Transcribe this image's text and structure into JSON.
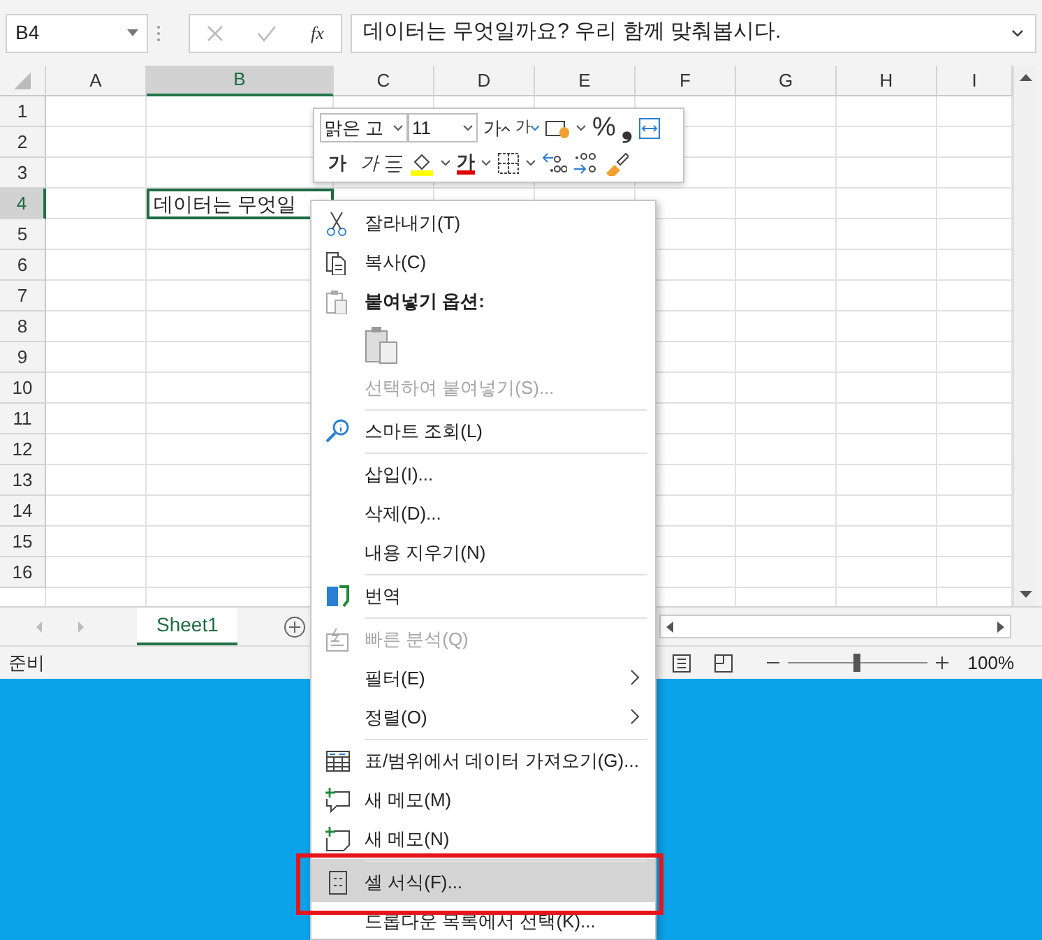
{
  "name_box": {
    "value": "B4"
  },
  "formula_bar": {
    "function_label": "fx",
    "value": "데이터는 무엇일까요? 우리 함께 맞춰봅시다."
  },
  "columns": [
    {
      "label": "A",
      "selected": false
    },
    {
      "label": "B",
      "selected": true
    },
    {
      "label": "C",
      "selected": false
    },
    {
      "label": "D",
      "selected": false
    },
    {
      "label": "E",
      "selected": false
    },
    {
      "label": "F",
      "selected": false
    },
    {
      "label": "G",
      "selected": false
    },
    {
      "label": "H",
      "selected": false
    },
    {
      "label": "I",
      "selected": false
    }
  ],
  "rows": [
    {
      "label": "1",
      "selected": false
    },
    {
      "label": "2",
      "selected": false
    },
    {
      "label": "3",
      "selected": false
    },
    {
      "label": "4",
      "selected": true
    },
    {
      "label": "5",
      "selected": false
    },
    {
      "label": "6",
      "selected": false
    },
    {
      "label": "7",
      "selected": false
    },
    {
      "label": "8",
      "selected": false
    },
    {
      "label": "9",
      "selected": false
    },
    {
      "label": "10",
      "selected": false
    },
    {
      "label": "11",
      "selected": false
    },
    {
      "label": "12",
      "selected": false
    },
    {
      "label": "13",
      "selected": false
    },
    {
      "label": "14",
      "selected": false
    },
    {
      "label": "15",
      "selected": false
    },
    {
      "label": "16",
      "selected": false
    }
  ],
  "active_cell": {
    "text": "데이터는 무엇일"
  },
  "sheet_tabs": [
    {
      "label": "Sheet1",
      "selected": true
    }
  ],
  "status_bar": {
    "status": "준비",
    "zoom_slider": {
      "level": 0.5
    },
    "zoom": "100%"
  },
  "mini_toolbar": {
    "font": "맑은 고",
    "size": "11",
    "grow": "가",
    "shrink": "가",
    "percent": "%",
    "comma": "❟",
    "bold": "가",
    "italic": "가",
    "font_color_label": "가"
  },
  "context_menu": [
    {
      "kind": "item",
      "label": "잘라내기(T)",
      "disabled": false,
      "submenu": false,
      "selected": false,
      "divider_before": false
    },
    {
      "kind": "item",
      "label": "복사(C)",
      "disabled": false,
      "submenu": false,
      "selected": false,
      "divider_before": false
    },
    {
      "kind": "header",
      "label": "붙여넣기 옵션:",
      "disabled": false,
      "submenu": false,
      "selected": false,
      "divider_before": false
    },
    {
      "kind": "paste-options"
    },
    {
      "kind": "item",
      "label": "선택하여 붙여넣기(S)...",
      "disabled": true,
      "submenu": false,
      "selected": false,
      "divider_before": false
    },
    {
      "kind": "item",
      "label": "스마트 조회(L)",
      "disabled": false,
      "submenu": false,
      "selected": false,
      "divider_before": true
    },
    {
      "kind": "item",
      "label": "삽입(I)...",
      "disabled": false,
      "submenu": false,
      "selected": false,
      "divider_before": true
    },
    {
      "kind": "item",
      "label": "삭제(D)...",
      "disabled": false,
      "submenu": false,
      "selected": false,
      "divider_before": false
    },
    {
      "kind": "item",
      "label": "내용 지우기(N)",
      "disabled": false,
      "submenu": false,
      "selected": false,
      "divider_before": false
    },
    {
      "kind": "item",
      "label": "번역",
      "disabled": false,
      "submenu": false,
      "selected": false,
      "divider_before": true
    },
    {
      "kind": "item",
      "label": "빠른 분석(Q)",
      "disabled": true,
      "submenu": false,
      "selected": false,
      "divider_before": true
    },
    {
      "kind": "item",
      "label": "필터(E)",
      "disabled": false,
      "submenu": true,
      "selected": false,
      "divider_before": false
    },
    {
      "kind": "item",
      "label": "정렬(O)",
      "disabled": false,
      "submenu": true,
      "selected": false,
      "divider_before": false
    },
    {
      "kind": "item",
      "label": "표/범위에서 데이터 가져오기(G)...",
      "disabled": false,
      "submenu": false,
      "selected": false,
      "divider_before": true
    },
    {
      "kind": "item",
      "label": "새 메모(M)",
      "disabled": false,
      "submenu": false,
      "selected": false,
      "divider_before": false
    },
    {
      "kind": "item",
      "label": "새 메모(N)",
      "disabled": false,
      "submenu": false,
      "selected": false,
      "divider_before": false
    },
    {
      "kind": "item",
      "label": "셀 서식(F)...",
      "disabled": false,
      "submenu": false,
      "selected": true,
      "outlined": true,
      "divider_before": true
    },
    {
      "kind": "item",
      "label": "드롭다운 목록에서 선택(K)...",
      "disabled": false,
      "submenu": false,
      "selected": false,
      "divider_before": false
    }
  ]
}
